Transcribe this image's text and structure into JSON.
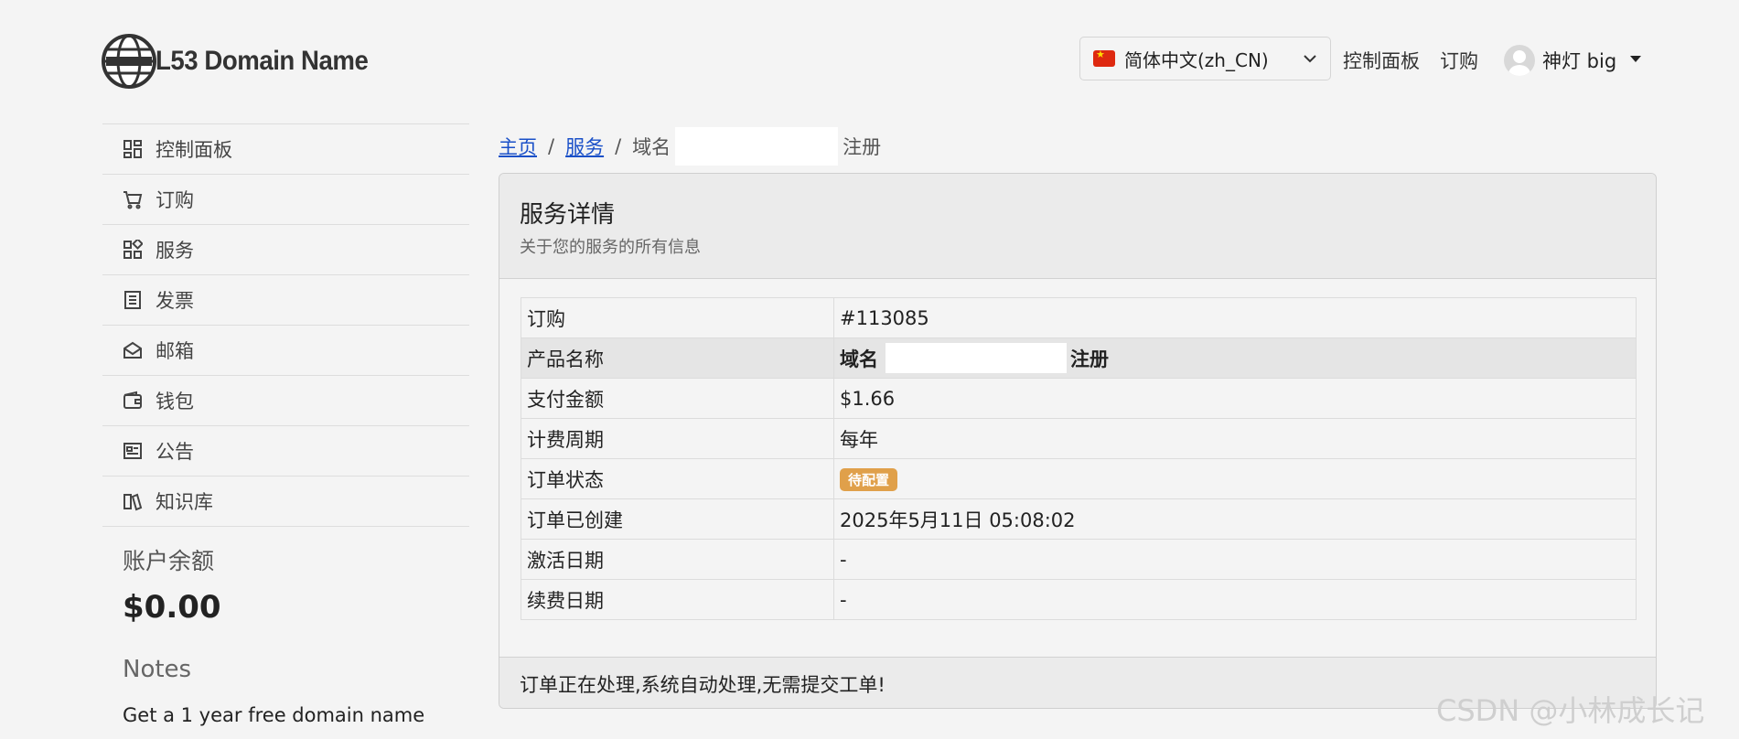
{
  "brand": {
    "name": "L53 Domain Name",
    "logo_icon": "globe-logo-icon"
  },
  "header": {
    "language": "简体中文(zh_CN)",
    "nav": [
      "控制面板",
      "订购"
    ],
    "user": "神灯 big"
  },
  "sidebar": {
    "items": [
      {
        "label": "控制面板",
        "icon": "dashboard-icon"
      },
      {
        "label": "订购",
        "icon": "cart-icon"
      },
      {
        "label": "服务",
        "icon": "services-icon"
      },
      {
        "label": "发票",
        "icon": "invoice-icon"
      },
      {
        "label": "邮箱",
        "icon": "mail-icon"
      },
      {
        "label": "钱包",
        "icon": "wallet-icon"
      },
      {
        "label": "公告",
        "icon": "announcement-icon"
      },
      {
        "label": "知识库",
        "icon": "knowledge-base-icon"
      }
    ],
    "balance_title": "账户余额",
    "balance_value": "$0.00",
    "notes_title": "Notes",
    "notes_text": "Get a 1 year free domain name"
  },
  "breadcrumb": {
    "home": "主页",
    "services": "服务",
    "current_prefix": "域名",
    "current_suffix": "注册"
  },
  "card": {
    "title": "服务详情",
    "subtitle": "关于您的服务的所有信息",
    "rows": [
      {
        "key": "订购",
        "value": "#113085"
      },
      {
        "key": "产品名称",
        "value_prefix": "域名",
        "value_suffix": "注册"
      },
      {
        "key": "支付金额",
        "value": "$1.66"
      },
      {
        "key": "计费周期",
        "value": "每年"
      },
      {
        "key": "订单状态",
        "badge": "待配置"
      },
      {
        "key": "订单已创建",
        "value": "2025年5月11日 05:08:02"
      },
      {
        "key": "激活日期",
        "value": "-"
      },
      {
        "key": "续费日期",
        "value": "-"
      }
    ],
    "footer": "订单正在处理,系统自动处理,无需提交工单!"
  },
  "watermark": "CSDN @小林成长记",
  "colors": {
    "link": "#1a50c8",
    "badge": "#e0a04a",
    "background": "#f4f4f4"
  }
}
